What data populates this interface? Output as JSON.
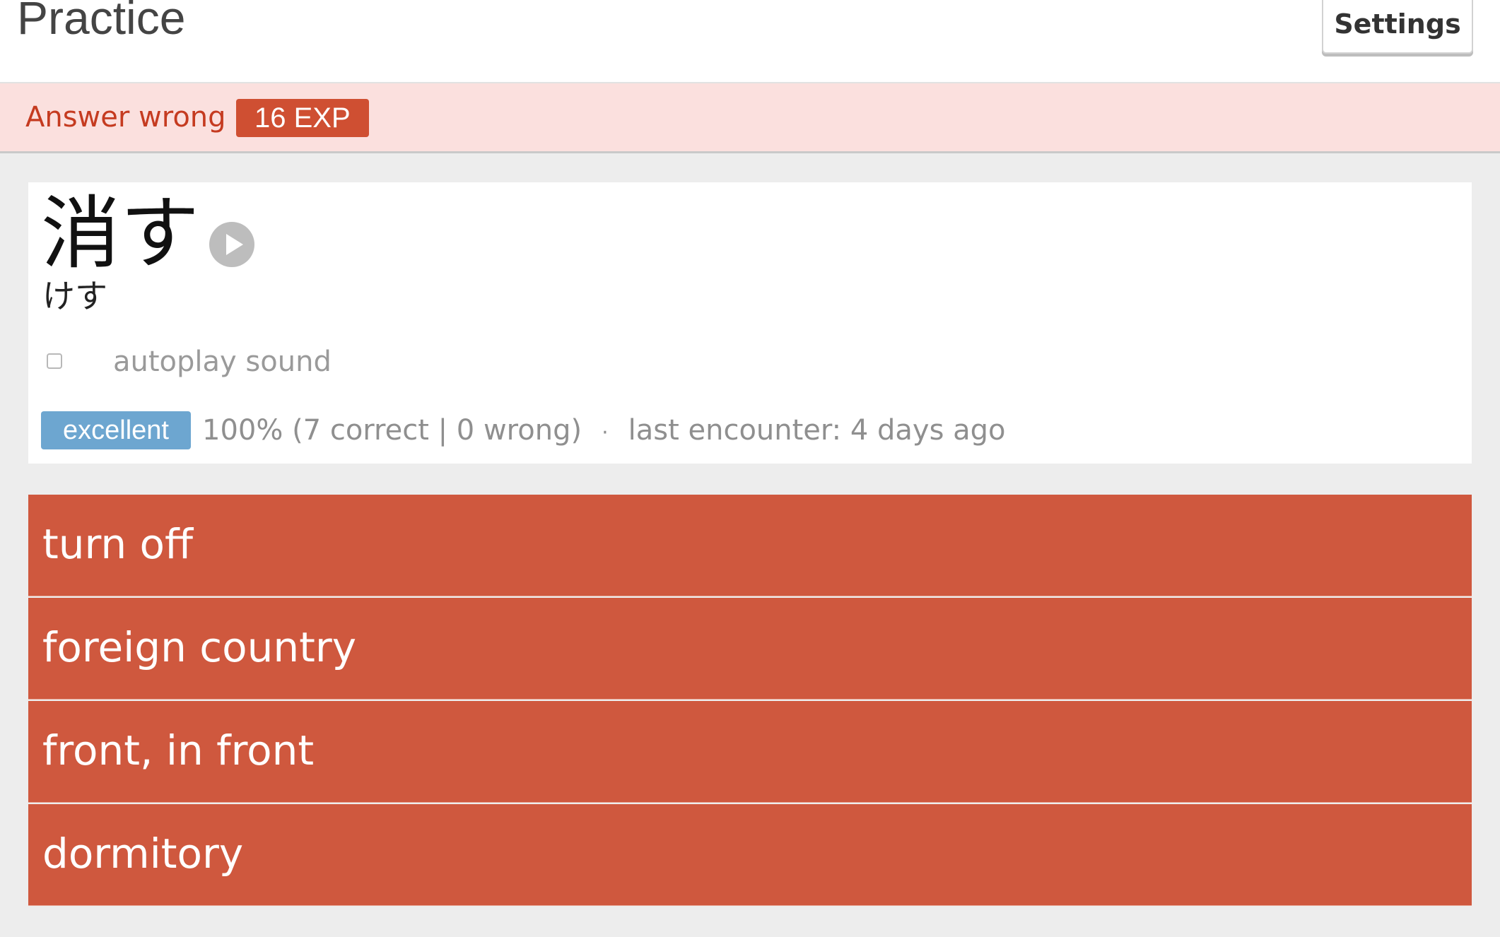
{
  "header": {
    "title": "Practice",
    "settings_label": "Settings"
  },
  "alert": {
    "text": "Answer wrong",
    "exp_badge": "16 EXP"
  },
  "word": {
    "kanji": "消す",
    "reading": "けす",
    "play_icon": "play-circle-icon"
  },
  "autoplay": {
    "label": "autoplay sound",
    "checked": false
  },
  "stats": {
    "level_badge": "excellent",
    "score": "100% (7 correct | 0 wrong)",
    "separator": "·",
    "last_encounter": "last encounter: 4 days ago"
  },
  "options": [
    {
      "label": "turn off"
    },
    {
      "label": "foreign country"
    },
    {
      "label": "front, in front"
    },
    {
      "label": "dormitory"
    }
  ],
  "colors": {
    "alert_bg": "#fbe0de",
    "alert_text": "#c53b20",
    "exp_badge": "#cf4f32",
    "level_badge": "#6da6d0",
    "option_bg": "#cf583e"
  }
}
